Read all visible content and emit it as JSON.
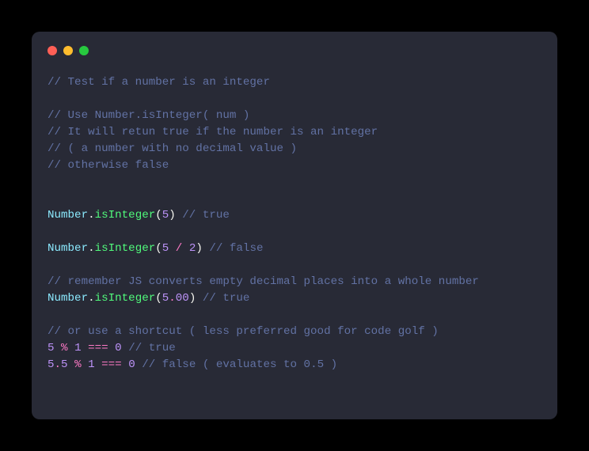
{
  "window": {
    "controls": [
      "close",
      "minimize",
      "maximize"
    ]
  },
  "code": {
    "c1": "// Test if a number is an integer",
    "c2": "// Use Number.isInteger( num )",
    "c3": "// It will retun true if the number is an integer",
    "c4": "// ( a number with no decimal value )",
    "c5": "// otherwise false",
    "cls1": "Number",
    "dot1": ".",
    "fn1": "isInteger",
    "lp1": "(",
    "n1": "5",
    "rp1": ")",
    "cr1": "// true",
    "cls2": "Number",
    "dot2": ".",
    "fn2": "isInteger",
    "lp2": "(",
    "n2a": "5",
    "div1": "/",
    "n2b": "2",
    "rp2": ")",
    "cr2": "// false",
    "c6": "// remember JS converts empty decimal places into a whole number",
    "cls3": "Number",
    "dot3": ".",
    "fn3": "isInteger",
    "lp3": "(",
    "n3a": "5",
    "dot3b": ".",
    "n3b": "00",
    "rp3": ")",
    "cr3": "// true",
    "c7": "// or use a shortcut ( less preferred good for code golf )",
    "n4a": "5",
    "mod1": "%",
    "n4b": "1",
    "eq1": "===",
    "n4c": "0",
    "cr4": "// true",
    "n5a": "5",
    "dot5": ".",
    "n5b": "5",
    "mod2": "%",
    "n5c": "1",
    "eq2": "===",
    "n5d": "0",
    "cr5": "// false ( evaluates to 0.5 )"
  }
}
